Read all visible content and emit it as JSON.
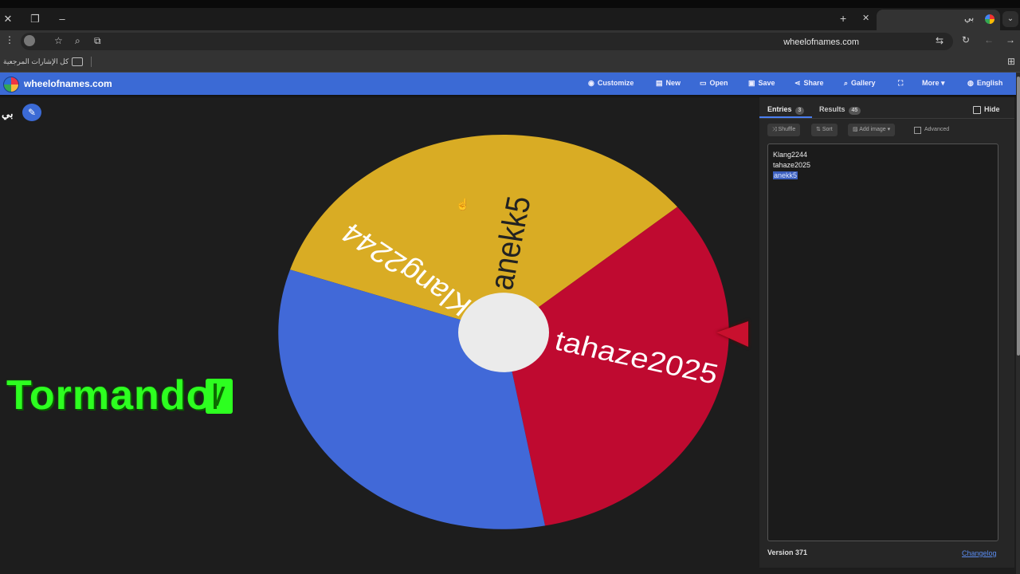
{
  "browser": {
    "tab_title": "بي",
    "url": "wheelofnames.com",
    "bookmarks_label": "كل الإشارات المرجعية"
  },
  "app": {
    "title": "wheelofnames.com",
    "menu": [
      {
        "label": "Customize",
        "icon": "palette-icon"
      },
      {
        "label": "New",
        "icon": "file-icon"
      },
      {
        "label": "Open",
        "icon": "folder-icon"
      },
      {
        "label": "Save",
        "icon": "save-icon"
      },
      {
        "label": "Share",
        "icon": "share-icon"
      },
      {
        "label": "Gallery",
        "icon": "search-icon"
      },
      {
        "label": "",
        "icon": "fullscreen-icon"
      },
      {
        "label": "More",
        "icon": "chevron-down-icon"
      },
      {
        "label": "English",
        "icon": "globe-icon"
      }
    ],
    "wheel_name": "بي"
  },
  "overlay_text": "Tormando",
  "wheel": {
    "segments": [
      {
        "label": "anekk5",
        "color": "#d9ac24"
      },
      {
        "label": "tahaze2025",
        "color": "#bf0a30"
      },
      {
        "label": "Klang2244",
        "color": "#4169d8"
      }
    ],
    "pointer_color": "#c8102e",
    "hub_color": "#ebebeb"
  },
  "panel": {
    "tab_entries": "Entries",
    "entries_count": "3",
    "tab_results": "Results",
    "results_count": "45",
    "hide_label": "Hide",
    "shuffle_label": "Shuffle",
    "sort_label": "Sort",
    "add_image_label": "Add image",
    "advanced_label": "Advanced",
    "entries": [
      "Klang2244",
      "tahaze2025",
      "anekk5"
    ],
    "version": "Version 371",
    "changelog": "Changelog"
  }
}
